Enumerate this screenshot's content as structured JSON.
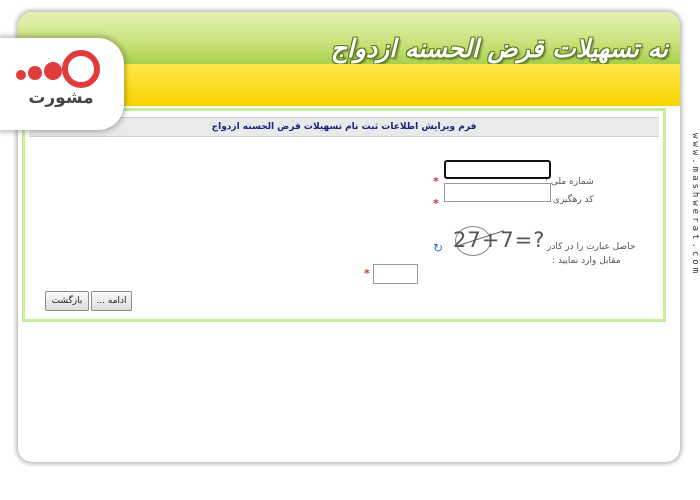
{
  "brand": {
    "banner_title": "نه تسهیلات قرض الحسنه ازدواج",
    "logo_text": "مشورت",
    "side_url": "www.mashwerat.com"
  },
  "form": {
    "header": "فرم ویرایش اطلاعات ثبت نام تسهیلات قرض الحسنه ازدواج",
    "fields": [
      {
        "label": "شماره ملی :",
        "value": "",
        "required": "*"
      },
      {
        "label": "کد رهگیری :",
        "value": "",
        "required": "*"
      }
    ],
    "captcha": {
      "label_line1": "حاصل عبارت را در کادر",
      "label_line2": "مقابل وارد نمایید :",
      "expression": "27+7=?",
      "answer_value": "",
      "required": "*"
    },
    "buttons": {
      "continue": "ادامه ...",
      "back": "بازگشت"
    }
  },
  "colors": {
    "banner_green": "#b5d85a",
    "banner_yellow": "#f9dc1c",
    "panel_border": "#c7ef9b",
    "header_text": "#1a237e",
    "required_star": "#d32f2f"
  }
}
